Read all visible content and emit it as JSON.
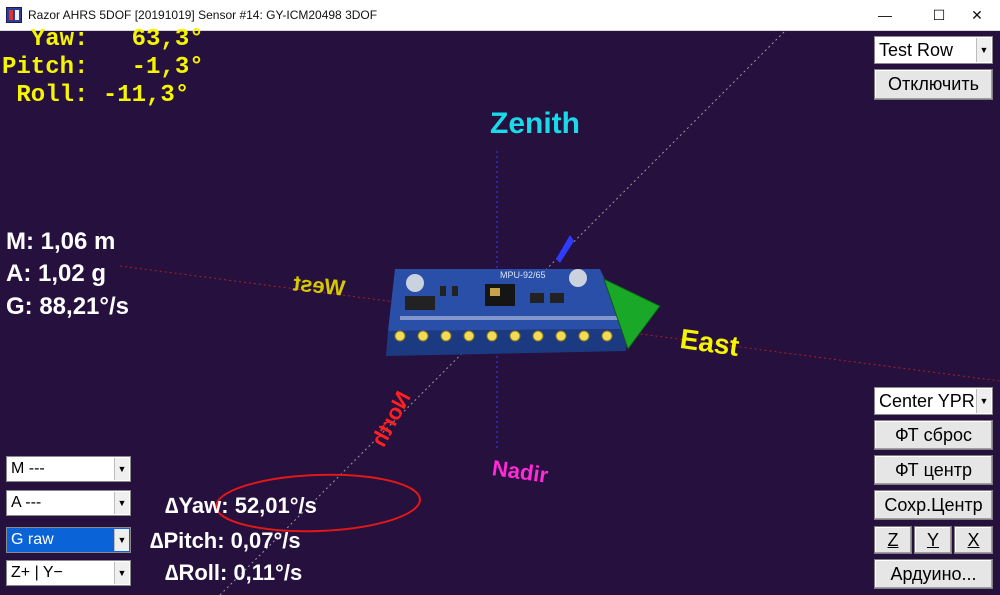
{
  "window": {
    "title": "Razor AHRS 5DOF [20191019] Sensor #14: GY-ICM20498 3DOF",
    "minimize": "—",
    "maximize": "☐",
    "close": "✕"
  },
  "angles": {
    "yaw": "  Yaw:   63,3°",
    "pitch": "Pitch:   -1,3°",
    "roll": " Roll: -11,3°"
  },
  "magnitudes": {
    "m": "M:  1,06 m",
    "a": "A:  1,02  g",
    "g": "G:  88,21°/s"
  },
  "directions": {
    "zenith": "Zenith",
    "nadir": "Nadir",
    "east": "East",
    "west": "West",
    "north": "North"
  },
  "board": {
    "label": "MPU-92/65"
  },
  "deltas": {
    "yaw": "∆Yaw: 52,01°/s",
    "pitch": "∆Pitch: 0,07°/s",
    "roll": "∆Roll: 0,11°/s"
  },
  "left_selects": {
    "m": "M ---",
    "a": "A ---",
    "g": "G raw",
    "axes": "Z+  |  Y−"
  },
  "right_controls": {
    "test_row": "Test Row",
    "disconnect": "Отключить",
    "center_ypr": "Center YPR",
    "ft_reset": "ФТ сброс",
    "ft_center": "ФТ центр",
    "save_center": "Сохр.Центр",
    "z": "Z",
    "y": "Y",
    "x": "X",
    "arduino": "Ардуино..."
  },
  "colors": {
    "background": "#25103e",
    "hud_yellow": "#f5f500",
    "zenith": "#1ad9e8",
    "nadir": "#ff2bd6",
    "board": "#2a4fa8",
    "annotation": "#e01818"
  }
}
